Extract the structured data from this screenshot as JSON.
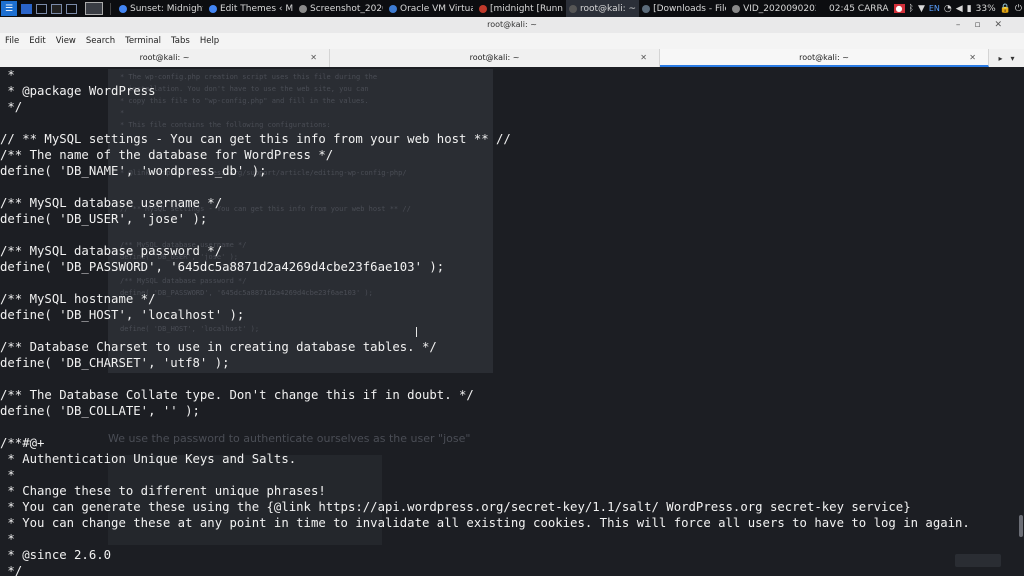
{
  "taskbar": {
    "tasks": [
      {
        "label": "Sunset: Midnight ...",
        "color": "#4285f4"
      },
      {
        "label": "Edit Themes ‹ Mid...",
        "color": "#4285f4"
      },
      {
        "label": "Screenshot_2020...",
        "color": "#8a8a8a"
      },
      {
        "label": "Oracle VM Virtual...",
        "color": "#3d7bd1"
      },
      {
        "label": "[midnight [Runnin...",
        "color": "#c0392b"
      },
      {
        "label": "root@kali: ~",
        "color": "#555555"
      },
      {
        "label": "[Downloads - File...",
        "color": "#5b6b7a"
      },
      {
        "label": "VID_2020090202...",
        "color": "#888888"
      }
    ],
    "clock": "02:45 CARRA",
    "keyboard": "EN",
    "battery": "33%"
  },
  "window": {
    "title": "root@kali: ~"
  },
  "menu": [
    "File",
    "Edit",
    "View",
    "Search",
    "Terminal",
    "Tabs",
    "Help"
  ],
  "tabs": [
    {
      "label": "root@kali: ~",
      "active": false
    },
    {
      "label": "root@kali: ~",
      "active": false
    },
    {
      "label": "root@kali: ~",
      "active": true
    }
  ],
  "ghost": {
    "lines": [
      " * The wp-config.php creation script uses this file during the",
      " * installation. You don't have to use the web site, you can",
      " * copy this file to \"wp-config.php\" and fill in the values.",
      " *",
      " * This file contains the following configurations:",
      "",
      "",
      "",
      " * @link https://wordpress.org/support/article/editing-wp-config-php/",
      "",
      "",
      "// ** MySQL settings - You can get this info from your web host ** //",
      "",
      "",
      "/** MySQL database username */",
      "define( 'DB_USER', 'jose' );",
      "",
      "/** MySQL database password */",
      "define( 'DB_PASSWORD', '645dc5a8871d2a4269d4cbe23f6ae103' );",
      "",
      "",
      "define( 'DB_HOST', 'localhost' );"
    ],
    "prose": "We use the password to authenticate ourselves as the user \"jose\""
  },
  "code_lines": [
    " *",
    " * @package WordPress",
    " */",
    "",
    "// ** MySQL settings - You can get this info from your web host ** //",
    "/** The name of the database for WordPress */",
    "define( 'DB_NAME', 'wordpress_db' );",
    "",
    "/** MySQL database username */",
    "define( 'DB_USER', 'jose' );",
    "",
    "/** MySQL database password */",
    "define( 'DB_PASSWORD', '645dc5a8871d2a4269d4cbe23f6ae103' );",
    "",
    "/** MySQL hostname */",
    "define( 'DB_HOST', 'localhost' );",
    "",
    "/** Database Charset to use in creating database tables. */",
    "define( 'DB_CHARSET', 'utf8' );",
    "",
    "/** The Database Collate type. Don't change this if in doubt. */",
    "define( 'DB_COLLATE', '' );",
    "",
    "/**#@+",
    " * Authentication Unique Keys and Salts.",
    " *",
    " * Change these to different unique phrases!",
    " * You can generate these using the {@link https://api.wordpress.org/secret-key/1.1/salt/ WordPress.org secret-key service}",
    " * You can change these at any point in time to invalidate all existing cookies. This will force all users to have to log in again.",
    " *",
    " * @since 2.6.0",
    " */"
  ]
}
